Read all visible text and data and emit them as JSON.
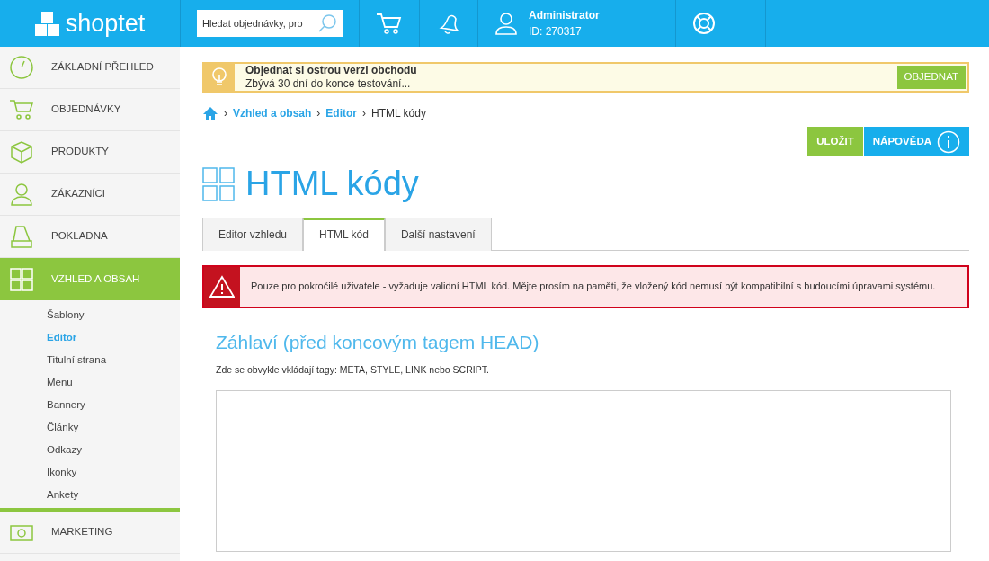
{
  "header": {
    "logo": "shoptet",
    "search": {
      "value": "Hledat objednávky, pro"
    },
    "user": {
      "name": "Administrator",
      "id": "ID: 270317"
    }
  },
  "sidebar": {
    "items": [
      {
        "label": "ZÁKLADNÍ PŘEHLED",
        "selected": false
      },
      {
        "label": "OBJEDNÁVKY",
        "selected": false
      },
      {
        "label": "PRODUKTY",
        "selected": false
      },
      {
        "label": "ZÁKAZNÍCI",
        "selected": false
      },
      {
        "label": "POKLADNA",
        "selected": false
      },
      {
        "label": "VZHLED A OBSAH",
        "selected": true,
        "children": [
          {
            "label": "Šablony",
            "selected": false
          },
          {
            "label": "Editor",
            "selected": true
          },
          {
            "label": "Titulní strana",
            "selected": false
          },
          {
            "label": "Menu",
            "selected": false
          },
          {
            "label": "Bannery",
            "selected": false
          },
          {
            "label": "Články",
            "selected": false
          },
          {
            "label": "Odkazy",
            "selected": false
          },
          {
            "label": "Ikonky",
            "selected": false
          },
          {
            "label": "Ankety",
            "selected": false
          }
        ]
      },
      {
        "label": "MARKETING",
        "selected": false
      }
    ]
  },
  "trial_banner": {
    "title": "Objednat si ostrou verzi obchodu",
    "text": "Zbývá 30 dní do konce testování...",
    "button": "OBJEDNAT"
  },
  "breadcrumb": [
    {
      "separator": "›",
      "label": "Vzhled a obsah",
      "link": true
    },
    {
      "separator": "›",
      "label": "Editor",
      "link": true
    },
    {
      "separator": "›",
      "label": "HTML kódy",
      "link": false
    }
  ],
  "actions": {
    "save": "ULOŽIT",
    "help": "NÁPOVĚDA"
  },
  "page_title": "HTML kódy",
  "tabs": [
    {
      "label": "Editor vzhledu",
      "selected": false
    },
    {
      "label": "HTML kód",
      "selected": true
    },
    {
      "label": "Další nastavení",
      "selected": false
    }
  ],
  "warning": "Pouze pro pokročilé uživatele - vyžaduje validní HTML kód. Mějte prosím na paměti, že vložený kód nemusí být kompatibilní s budoucími úpravami systému.",
  "section": {
    "title": "Záhlaví (před koncovým tagem HEAD)",
    "hint": "Zde se obvykle vkládají tagy: META, STYLE, LINK nebo SCRIPT."
  }
}
